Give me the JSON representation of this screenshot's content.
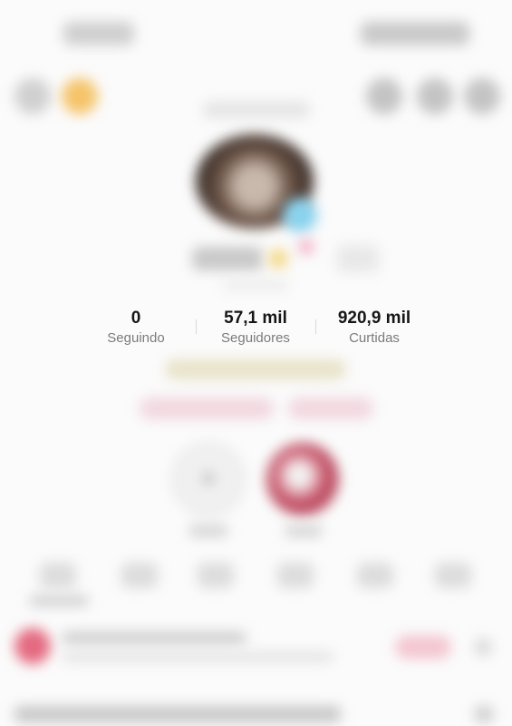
{
  "stats": [
    {
      "value": "0",
      "label": "Seguindo"
    },
    {
      "value": "57,1 mil",
      "label": "Seguidores"
    },
    {
      "value": "920,9 mil",
      "label": "Curtidas"
    }
  ],
  "colors": {
    "coin": "#f5c46a",
    "avatar_badge": "#8ad2ee",
    "accent": "#e46a80"
  },
  "icons": {
    "search": "search-icon",
    "coins": "coin-icon",
    "add_story": "plus-icon",
    "menu": "menu-icon"
  }
}
